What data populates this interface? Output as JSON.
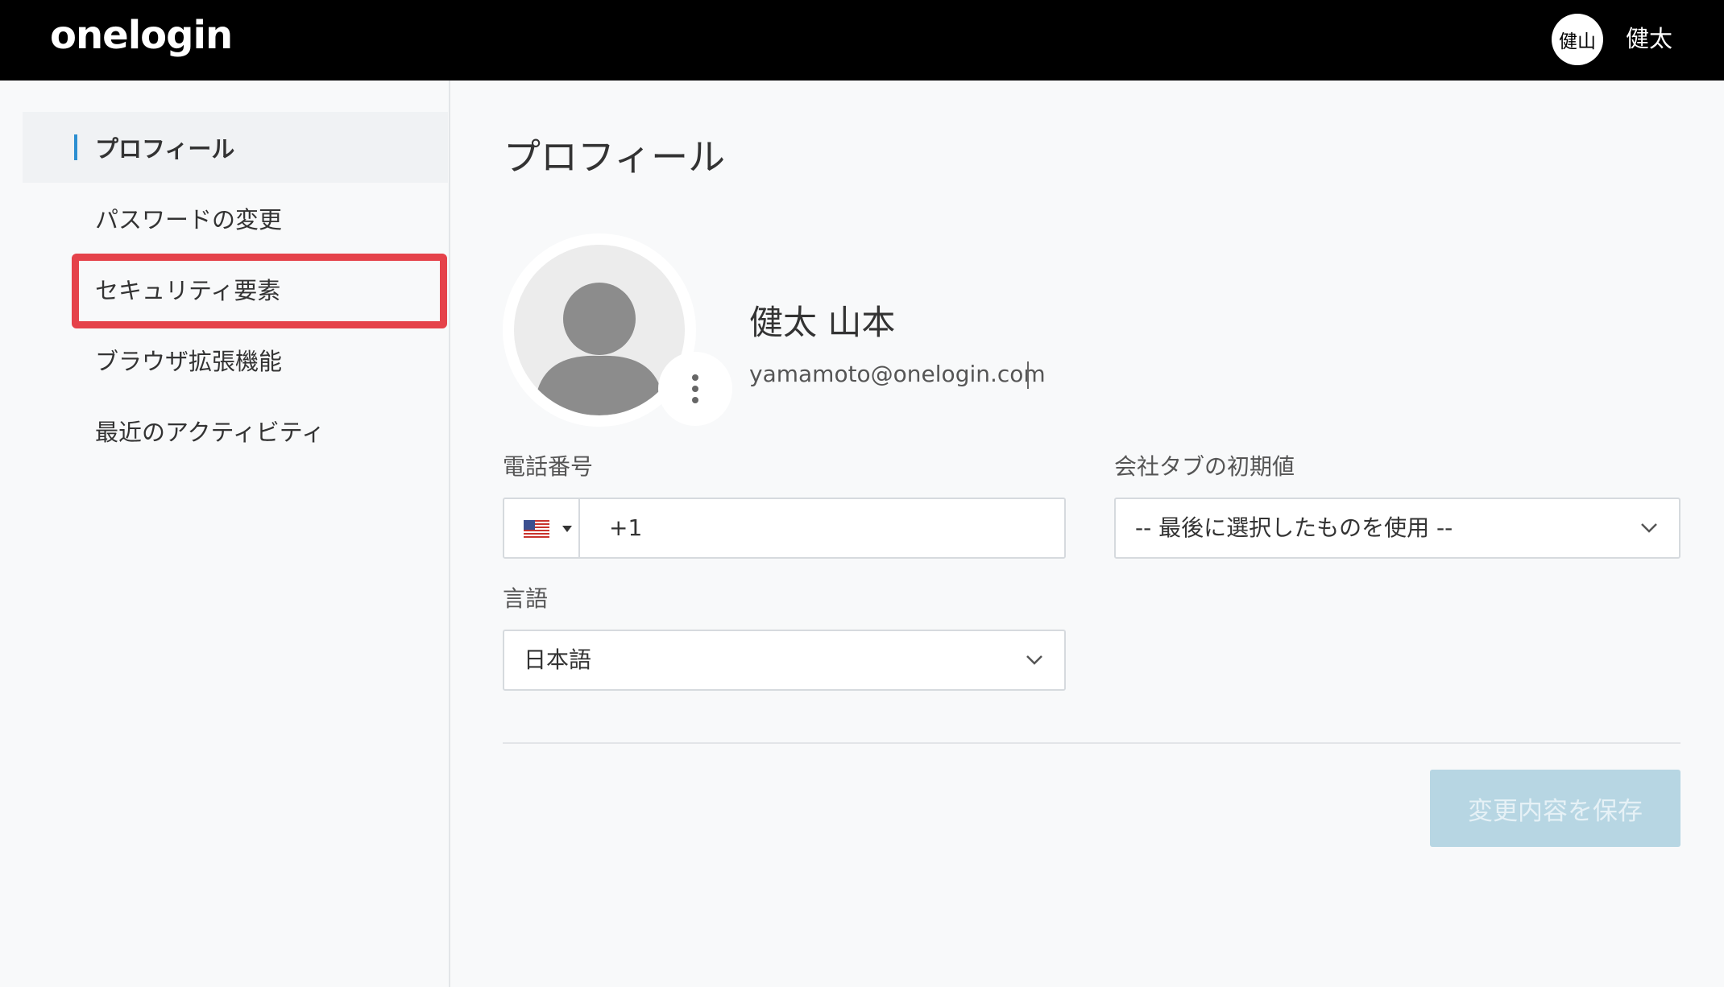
{
  "header": {
    "logo": "onelogin",
    "avatar_initials": "健山",
    "user_name": "健太"
  },
  "sidebar": {
    "items": [
      {
        "label": "プロフィール",
        "active": true
      },
      {
        "label": "パスワードの変更",
        "active": false
      },
      {
        "label": "セキュリティ要素",
        "active": false
      },
      {
        "label": "ブラウザ拡張機能",
        "active": false
      },
      {
        "label": "最近のアクティビティ",
        "active": false
      }
    ]
  },
  "main": {
    "title": "プロフィール",
    "full_name": "健太 山本",
    "email": "yamamoto@onelogin.com",
    "phone": {
      "label": "電話番号",
      "country_icon": "us-flag-icon",
      "value": "+1"
    },
    "company_tab": {
      "label": "会社タブの初期値",
      "value": "-- 最後に選択したものを使用 --"
    },
    "language": {
      "label": "言語",
      "value": "日本語"
    },
    "save_label": "変更内容を保存"
  },
  "colors": {
    "accent": "#2d8fd1",
    "highlight": "#e5424a",
    "save_button_disabled": "#b7d6e3"
  }
}
